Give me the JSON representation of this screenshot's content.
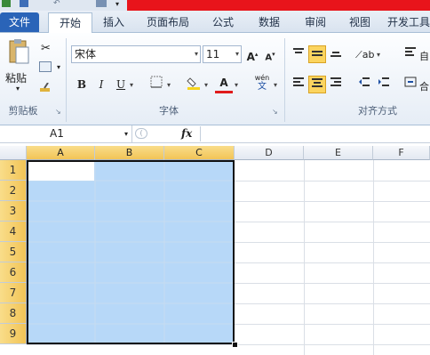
{
  "tabs": {
    "file": "文件",
    "home": "开始",
    "insert": "插入",
    "page_layout": "页面布局",
    "formulas": "公式",
    "data": "数据",
    "review": "审阅",
    "view": "视图",
    "developer": "开发工具"
  },
  "clipboard": {
    "paste": "粘贴",
    "group_label": "剪贴板"
  },
  "font": {
    "name": "宋体",
    "size": "11",
    "group_label": "字体",
    "bold": "B",
    "italic": "I",
    "underline": "U",
    "grow": "A",
    "shrink": "A",
    "font_color": "A",
    "phonetic": "wén"
  },
  "alignment": {
    "group_label": "对齐方式",
    "wrap_partial": "自",
    "merge_partial": "合"
  },
  "formula_bar": {
    "name_box": "A1",
    "fx": "fx",
    "content": ""
  },
  "grid": {
    "columns": [
      "A",
      "B",
      "C",
      "D",
      "E",
      "F"
    ],
    "rows": [
      "1",
      "2",
      "3",
      "4",
      "5",
      "6",
      "7",
      "8",
      "9"
    ],
    "selected_range": "A1:C9",
    "selection_color": "#b7d8f8",
    "header_highlight_color": "#f2c456"
  },
  "colors": {
    "accent_red": "#e8141b",
    "file_tab": "#2a64b8"
  }
}
